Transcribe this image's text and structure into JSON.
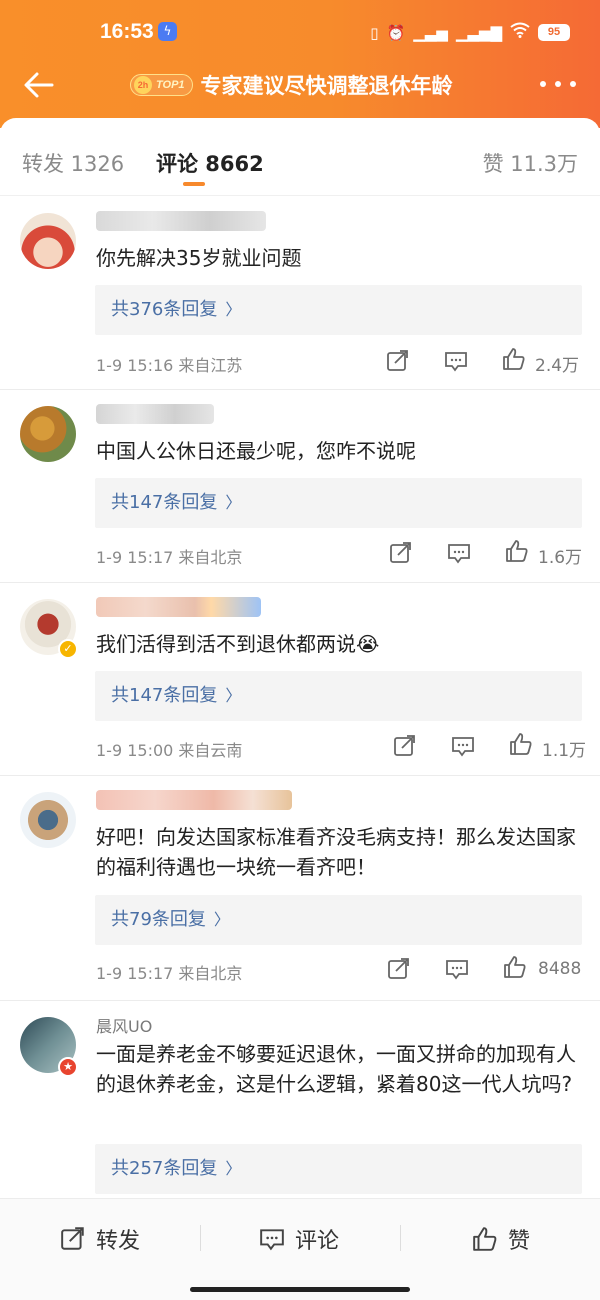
{
  "status_bar": {
    "time": "16:53",
    "battery": "95"
  },
  "header": {
    "title": "专家建议尽快调整退休年龄",
    "badge": "TOP1",
    "badge_icon_text": "2h"
  },
  "tabs": [
    {
      "label": "转发 1326"
    },
    {
      "label": "评论 8662"
    },
    {
      "label": "赞 11.3万"
    }
  ],
  "comments": [
    {
      "user": "",
      "text": "你先解决35岁就业问题",
      "replies": "共376条回复",
      "meta": "1-9 15:16  来自江苏",
      "likes": "2.4万"
    },
    {
      "user": "",
      "text": "中国人公休日还最少呢，您咋不说呢",
      "replies": "共147条回复",
      "meta": "1-9 15:17  来自北京",
      "likes": "1.6万"
    },
    {
      "user": "",
      "text": "我们活得到活不到退休都两说😭",
      "replies": "共147条回复",
      "meta": "1-9 15:00  来自云南",
      "likes": "1.1万"
    },
    {
      "user": "",
      "text": "好吧！向发达国家标准看齐没毛病支持！那么发达国家的福利待遇也一块统一看齐吧！",
      "replies": "共79条回复",
      "meta": "1-9 15:17  来自北京",
      "likes": "8488"
    },
    {
      "user": "晨风UO",
      "text": "一面是养老金不够要延迟退休，一面又拼命的加现有人的退休养老金，这是什么逻辑，紧着80这一代人坑吗?",
      "replies": "共257条回复",
      "meta": "",
      "likes": ""
    }
  ],
  "bottom": {
    "repost": "转发",
    "comment": "评论",
    "like": "赞"
  },
  "colors": {
    "accent": "#f7892c",
    "link": "#4a6fa5"
  }
}
